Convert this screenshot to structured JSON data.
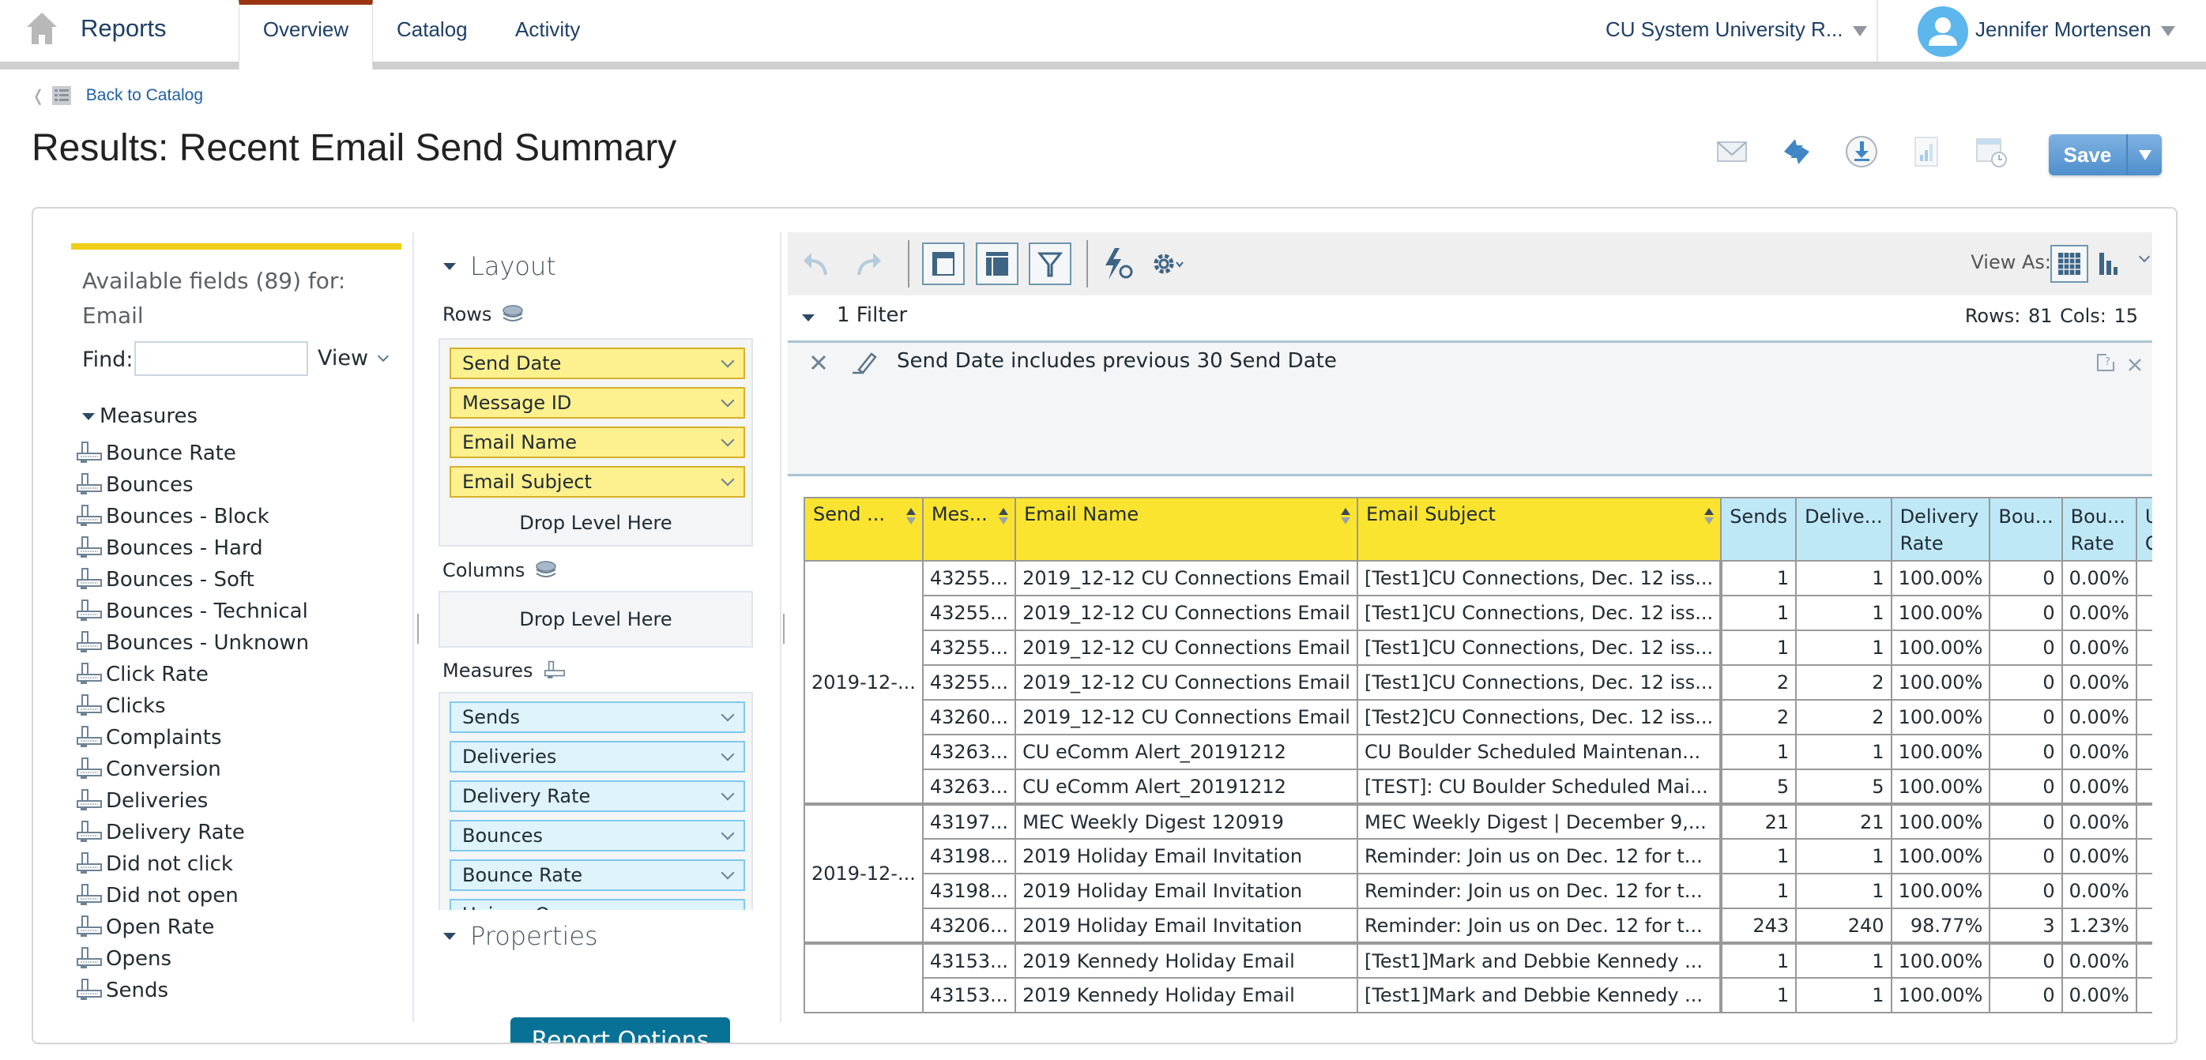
{
  "nav": {
    "app_name": "Reports",
    "tabs": [
      {
        "label": "Overview",
        "active": true
      },
      {
        "label": "Catalog",
        "active": false
      },
      {
        "label": "Activity",
        "active": false
      }
    ],
    "org_selector": "CU System University R...",
    "user_name": "Jennifer Mortensen",
    "active_tab_color": "#9a3412"
  },
  "back_link": "Back to Catalog",
  "page_title": "Results: Recent Email Send Summary",
  "actions": {
    "icons": [
      "email-icon",
      "refresh-icon",
      "download-icon",
      "chart-icon",
      "schedule-icon"
    ],
    "save_label": "Save"
  },
  "fields_panel": {
    "title_line1": "Available fields (89) for:",
    "title_line2": "Email",
    "find_label": "Find:",
    "find_value": "",
    "view_label": "View",
    "group_label": "Measures",
    "items": [
      "Bounce Rate",
      "Bounces",
      "Bounces - Block",
      "Bounces - Hard",
      "Bounces - Soft",
      "Bounces - Technical",
      "Bounces - Unknown",
      "Click Rate",
      "Clicks",
      "Complaints",
      "Conversion",
      "Deliveries",
      "Delivery Rate",
      "Did not click",
      "Did not open",
      "Open Rate",
      "Opens",
      "Sends"
    ]
  },
  "layout_panel": {
    "title": "Layout",
    "rows_label": "Rows",
    "rows": [
      "Send Date",
      "Message ID",
      "Email Name",
      "Email Subject"
    ],
    "drop_text": "Drop Level Here",
    "columns_label": "Columns",
    "measures_label": "Measures",
    "measures": [
      "Sends",
      "Deliveries",
      "Delivery Rate",
      "Bounces",
      "Bounce Rate",
      "Unique Opens"
    ],
    "properties_title": "Properties",
    "report_options_label": "Report Options"
  },
  "results": {
    "view_as_label": "View As:",
    "filter_count": "1 Filter",
    "rows_cols": "Rows: 81  Cols: 15",
    "filter": {
      "field": "Send Date",
      "rest": " includes previous 30 Send Date"
    },
    "table": {
      "dim_headers": [
        "Send ...",
        "Mes...",
        "Email Name",
        "Email Subject"
      ],
      "measure_headers": [
        "Sends",
        "Delive...",
        "Delivery Rate",
        "Bou...",
        "Bou... Rate",
        "Un Op"
      ],
      "groups": [
        {
          "send_date": "2019-12-...",
          "rows": [
            {
              "id": "43255...",
              "name": "2019_12-12 CU Connections Email",
              "subject": "[Test1]CU Connections, Dec. 12 iss...",
              "sends": "1",
              "deliveries": "1",
              "delivery_rate": "100.00%",
              "bounces": "0",
              "bounce_rate": "0.00%"
            },
            {
              "id": "43255...",
              "name": "2019_12-12 CU Connections Email",
              "subject": "[Test1]CU Connections, Dec. 12 iss...",
              "sends": "1",
              "deliveries": "1",
              "delivery_rate": "100.00%",
              "bounces": "0",
              "bounce_rate": "0.00%"
            },
            {
              "id": "43255...",
              "name": "2019_12-12 CU Connections Email",
              "subject": "[Test1]CU Connections, Dec. 12 iss...",
              "sends": "1",
              "deliveries": "1",
              "delivery_rate": "100.00%",
              "bounces": "0",
              "bounce_rate": "0.00%"
            },
            {
              "id": "43255...",
              "name": "2019_12-12 CU Connections Email",
              "subject": "[Test1]CU Connections, Dec. 12 iss...",
              "sends": "2",
              "deliveries": "2",
              "delivery_rate": "100.00%",
              "bounces": "0",
              "bounce_rate": "0.00%"
            },
            {
              "id": "43260...",
              "name": "2019_12-12 CU Connections Email",
              "subject": "[Test2]CU Connections, Dec. 12 iss...",
              "sends": "2",
              "deliveries": "2",
              "delivery_rate": "100.00%",
              "bounces": "0",
              "bounce_rate": "0.00%"
            },
            {
              "id": "43263...",
              "name": "CU eComm Alert_20191212",
              "subject": "CU Boulder Scheduled Maintenan...",
              "sends": "1",
              "deliveries": "1",
              "delivery_rate": "100.00%",
              "bounces": "0",
              "bounce_rate": "0.00%"
            },
            {
              "id": "43263...",
              "name": "CU eComm Alert_20191212",
              "subject": "[TEST]: CU Boulder Scheduled Mai...",
              "sends": "5",
              "deliveries": "5",
              "delivery_rate": "100.00%",
              "bounces": "0",
              "bounce_rate": "0.00%"
            }
          ]
        },
        {
          "send_date": "2019-12-...",
          "rows": [
            {
              "id": "43197...",
              "name": "MEC Weekly Digest 120919",
              "subject": "MEC Weekly Digest | December 9,...",
              "sends": "21",
              "deliveries": "21",
              "delivery_rate": "100.00%",
              "bounces": "0",
              "bounce_rate": "0.00%"
            },
            {
              "id": "43198...",
              "name": "2019 Holiday Email Invitation",
              "subject": "Reminder: Join us on Dec. 12 for t...",
              "sends": "1",
              "deliveries": "1",
              "delivery_rate": "100.00%",
              "bounces": "0",
              "bounce_rate": "0.00%"
            },
            {
              "id": "43198...",
              "name": "2019 Holiday Email Invitation",
              "subject": "Reminder: Join us on Dec. 12 for t...",
              "sends": "1",
              "deliveries": "1",
              "delivery_rate": "100.00%",
              "bounces": "0",
              "bounce_rate": "0.00%"
            },
            {
              "id": "43206...",
              "name": "2019 Holiday Email Invitation",
              "subject": "Reminder: Join us on Dec. 12 for t...",
              "sends": "243",
              "deliveries": "240",
              "delivery_rate": "98.77%",
              "bounces": "3",
              "bounce_rate": "1.23%"
            }
          ]
        },
        {
          "send_date": "",
          "rows": [
            {
              "id": "43153...",
              "name": "2019 Kennedy Holiday Email",
              "subject": "[Test1]Mark and Debbie Kennedy ...",
              "sends": "1",
              "deliveries": "1",
              "delivery_rate": "100.00%",
              "bounces": "0",
              "bounce_rate": "0.00%"
            },
            {
              "id": "43153...",
              "name": "2019 Kennedy Holiday Email",
              "subject": "[Test1]Mark and Debbie Kennedy ...",
              "sends": "1",
              "deliveries": "1",
              "delivery_rate": "100.00%",
              "bounces": "0",
              "bounce_rate": "0.00%"
            }
          ]
        }
      ]
    }
  }
}
